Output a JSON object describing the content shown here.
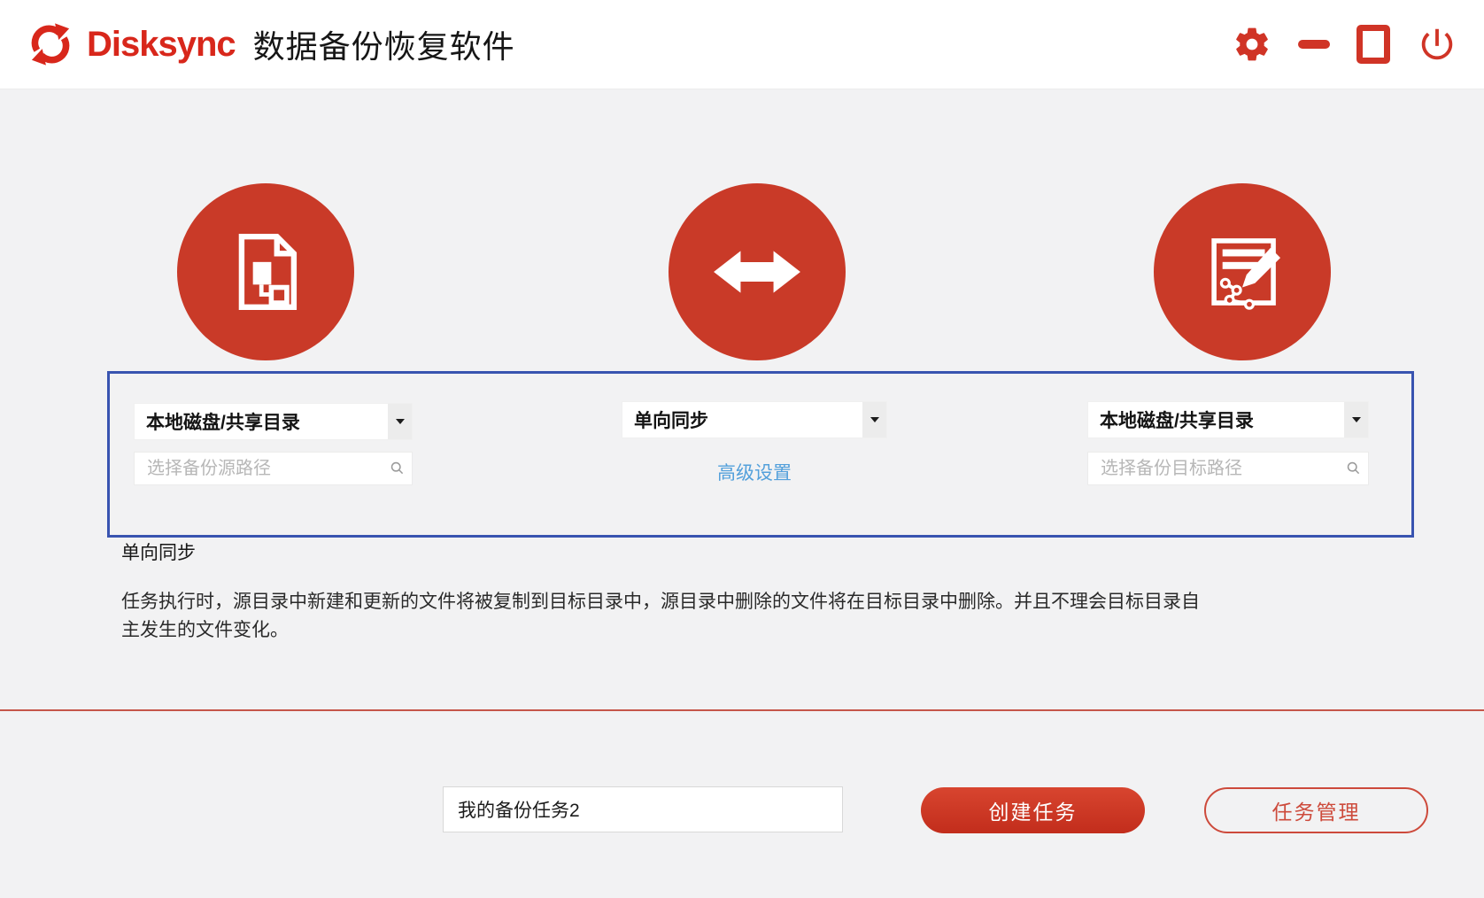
{
  "header": {
    "brand": "Disksync",
    "title": "数据备份恢复软件"
  },
  "window_controls": {
    "settings_icon": "gear-icon",
    "minimize_icon": "minus-icon",
    "maximize_icon": "square-icon",
    "close_icon": "power-icon"
  },
  "panel": {
    "source": {
      "type_selected": "本地磁盘/共享目录",
      "path_placeholder": "选择备份源路径"
    },
    "mode": {
      "type_selected": "单向同步",
      "advanced_link": "高级设置"
    },
    "target": {
      "type_selected": "本地磁盘/共享目录",
      "path_placeholder": "选择备份目标路径"
    }
  },
  "mode_info": {
    "title": "单向同步",
    "description": "任务执行时，源目录中新建和更新的文件将被复制到目标目录中，源目录中删除的文件将在目标目录中删除。并且不理会目标目录自主发生的文件变化。"
  },
  "footer": {
    "task_name_value": "我的备份任务2",
    "create_button": "创建任务",
    "manage_button": "任务管理"
  },
  "colors": {
    "brand_red": "#d8271b",
    "circle_red": "#c93a28",
    "control_red": "#d03426",
    "panel_border_blue": "#3954b0",
    "link_blue": "#53a0db",
    "divider_red": "#c5564a",
    "page_background": "#f2f2f3"
  }
}
